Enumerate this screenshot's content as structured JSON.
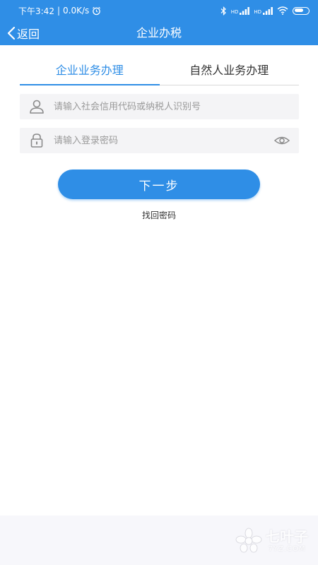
{
  "status_bar": {
    "time": "下午3:42",
    "separator": "|",
    "speed": "0.0K/s",
    "signal1_label": "HD",
    "signal2_label": "HD"
  },
  "nav": {
    "back_label": "返回",
    "title": "企业办税"
  },
  "tabs": [
    {
      "label": "企业业务办理",
      "active": true
    },
    {
      "label": "自然人业务办理",
      "active": false
    }
  ],
  "form": {
    "account_placeholder": "请输入社会信用代码或纳税人识别号",
    "password_placeholder": "请输入登录密码",
    "next_label": "下一步",
    "forgot_label": "找回密码"
  },
  "watermark": {
    "cn": "七叶子",
    "en": "7YZ.COM"
  },
  "colors": {
    "primary": "#2f8ee6",
    "field_bg": "#f4f4f6",
    "placeholder": "#9a9a9a"
  },
  "icons": {
    "back": "chevron-left-icon",
    "user": "user-icon",
    "lock": "lock-icon",
    "eye": "eye-icon",
    "alarm": "alarm-icon",
    "bluetooth": "bluetooth-icon",
    "wifi": "wifi-icon",
    "battery": "battery-icon"
  }
}
